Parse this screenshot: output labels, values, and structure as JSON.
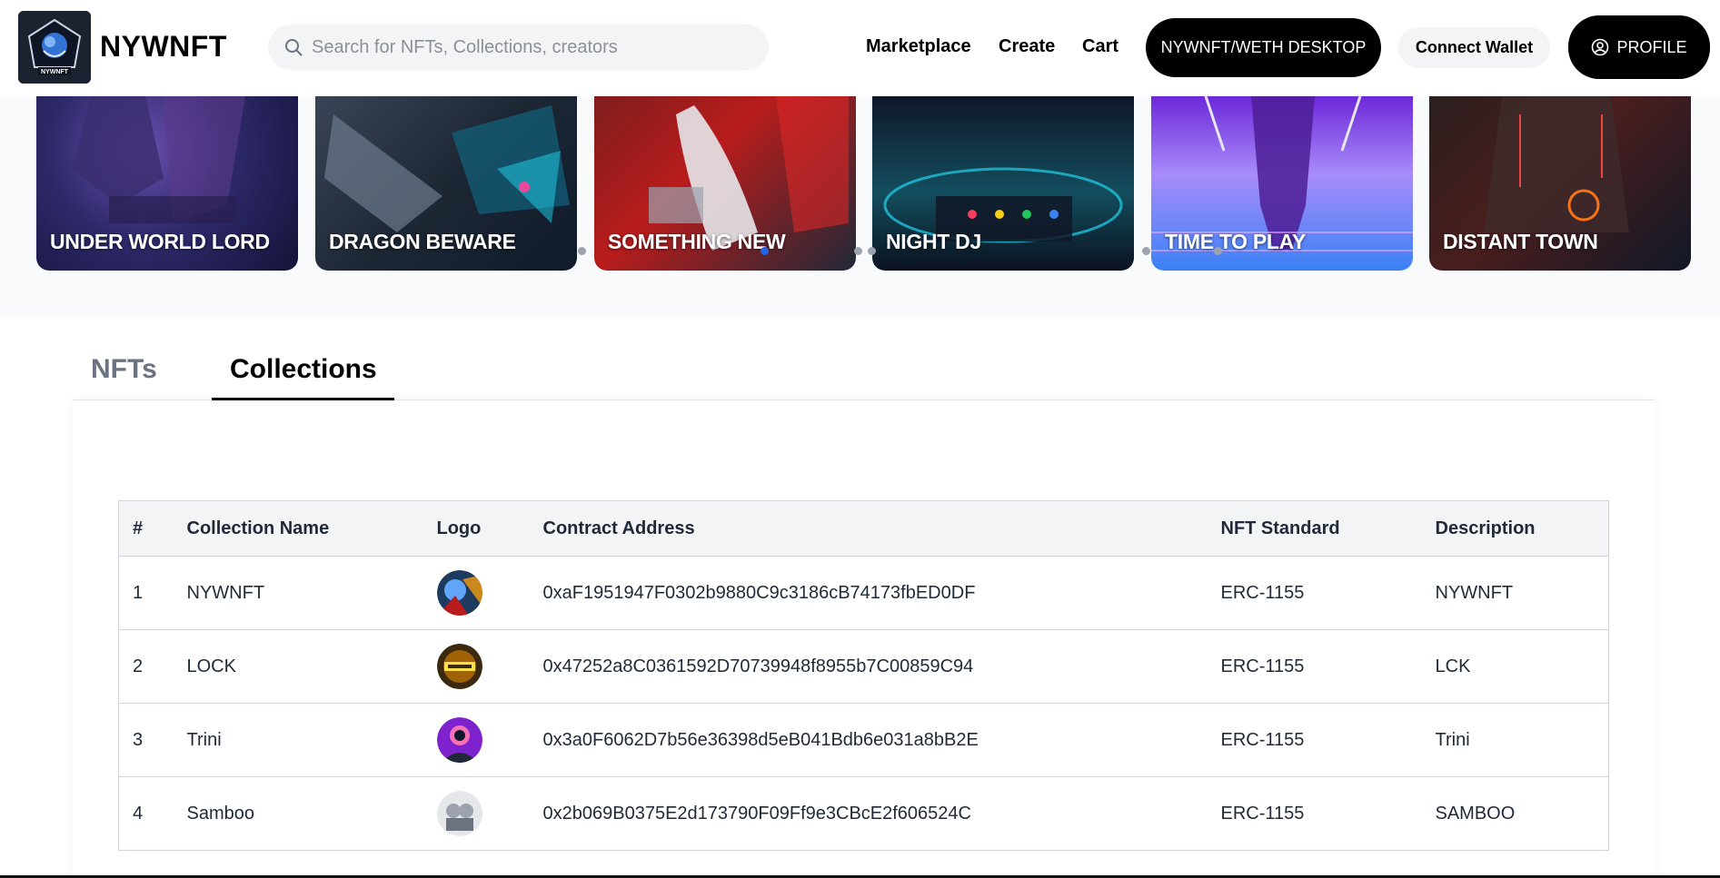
{
  "header": {
    "brand": "NYWNFT",
    "logo_text": "NYWNFT",
    "search_placeholder": "Search for NFTs, Collections, creators",
    "nav": [
      "Marketplace",
      "Create",
      "Cart"
    ],
    "desktop_button": "NYWNFT/WETH DESKTOP",
    "connect_wallet": "Connect Wallet",
    "profile": "PROFILE"
  },
  "carousel": {
    "cards": [
      {
        "title": "UNDER WORLD LORD"
      },
      {
        "title": "DRAGON BEWARE"
      },
      {
        "title": "SOMETHING NEW"
      },
      {
        "title": "NIGHT DJ"
      },
      {
        "title": "TIME TO PLAY"
      },
      {
        "title": "DISTANT TOWN"
      }
    ]
  },
  "tabs": {
    "nfts": "NFTs",
    "collections": "Collections",
    "active": "Collections"
  },
  "table": {
    "headers": [
      "#",
      "Collection Name",
      "Logo",
      "Contract Address",
      "NFT Standard",
      "Description"
    ],
    "rows": [
      {
        "num": "1",
        "name": "NYWNFT",
        "address": "0xaF1951947F0302b9880C9c3186cB74173fbED0DF",
        "standard": "ERC-1155",
        "description": "NYWNFT"
      },
      {
        "num": "2",
        "name": "LOCK",
        "address": "0x47252a8C0361592D70739948f8955b7C00859C94",
        "standard": "ERC-1155",
        "description": "LCK"
      },
      {
        "num": "3",
        "name": "Trini",
        "address": "0x3a0F6062D7b56e36398d5eB041Bdb6e031a8bB2E",
        "standard": "ERC-1155",
        "description": "Trini"
      },
      {
        "num": "4",
        "name": "Samboo",
        "address": "0x2b069B0375E2d173790F09Ff9e3CBcE2f606524C",
        "standard": "ERC-1155",
        "description": "SAMBOO"
      }
    ]
  },
  "colors": {
    "accent_dark": "#000000",
    "carousel_bg": "#f8fafc",
    "active_dot": "#2563eb"
  }
}
